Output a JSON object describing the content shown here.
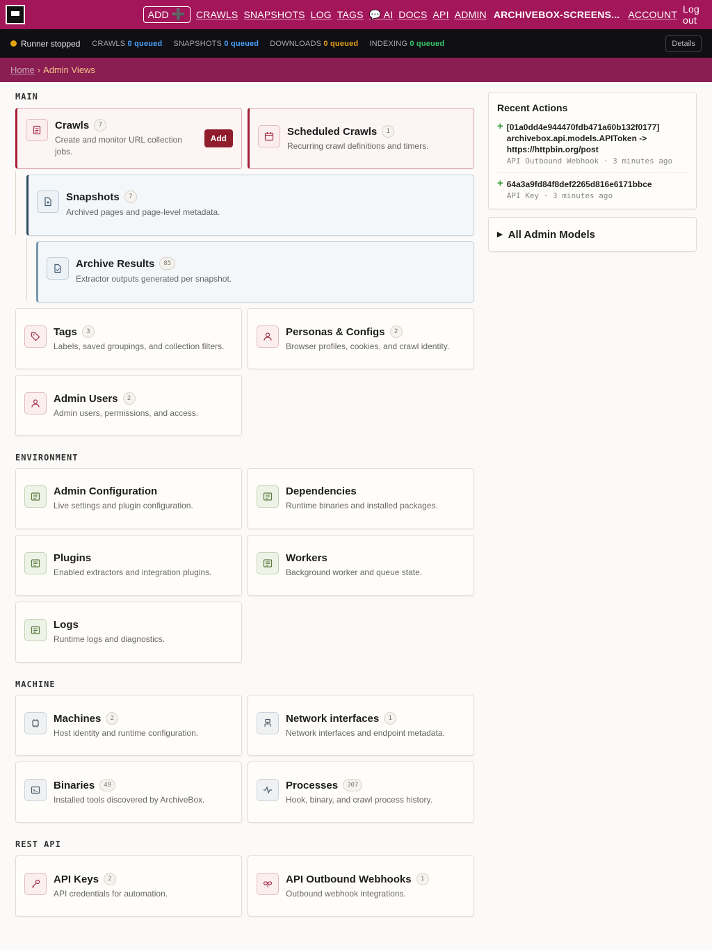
{
  "nav": {
    "add_label": "ADD",
    "links": [
      "CRAWLS",
      "SNAPSHOTS",
      "LOG",
      "TAGS",
      "💬 AI",
      "DOCS",
      "API",
      "ADMIN"
    ],
    "instance": "ARCHIVEBOX-SCREENS...",
    "account": "ACCOUNT",
    "logout": "Log out"
  },
  "status": {
    "runner": "Runner stopped",
    "crawls_label": "CRAWLS",
    "crawls_value": "0 queued",
    "snapshots_label": "SNAPSHOTS",
    "snapshots_value": "0 queued",
    "downloads_label": "DOWNLOADS",
    "downloads_value": "0 queued",
    "indexing_label": "INDEXING",
    "indexing_value": "0 queued",
    "details": "Details"
  },
  "breadcrumb": {
    "home": "Home",
    "sep": "›",
    "current": "Admin Views"
  },
  "sections": {
    "main": "MAIN",
    "environment": "ENVIRONMENT",
    "machine": "MACHINE",
    "rest_api": "REST API"
  },
  "cards": {
    "crawls": {
      "title": "Crawls",
      "count": "7",
      "desc": "Create and monitor URL collection jobs.",
      "add": "Add"
    },
    "scheduled": {
      "title": "Scheduled Crawls",
      "count": "1",
      "desc": "Recurring crawl definitions and timers."
    },
    "snapshots": {
      "title": "Snapshots",
      "count": "7",
      "desc": "Archived pages and page-level metadata."
    },
    "archive_results": {
      "title": "Archive Results",
      "count": "85",
      "desc": "Extractor outputs generated per snapshot."
    },
    "tags": {
      "title": "Tags",
      "count": "3",
      "desc": "Labels, saved groupings, and collection filters."
    },
    "personas": {
      "title": "Personas & Configs",
      "count": "2",
      "desc": "Browser profiles, cookies, and crawl identity."
    },
    "admin_users": {
      "title": "Admin Users",
      "count": "2",
      "desc": "Admin users, permissions, and access."
    },
    "admin_config": {
      "title": "Admin Configuration",
      "desc": "Live settings and plugin configuration."
    },
    "dependencies": {
      "title": "Dependencies",
      "desc": "Runtime binaries and installed packages."
    },
    "plugins": {
      "title": "Plugins",
      "desc": "Enabled extractors and integration plugins."
    },
    "workers": {
      "title": "Workers",
      "desc": "Background worker and queue state."
    },
    "logs": {
      "title": "Logs",
      "desc": "Runtime logs and diagnostics."
    },
    "machines": {
      "title": "Machines",
      "count": "2",
      "desc": "Host identity and runtime configuration."
    },
    "network": {
      "title": "Network interfaces",
      "count": "1",
      "desc": "Network interfaces and endpoint metadata."
    },
    "binaries": {
      "title": "Binaries",
      "count": "49",
      "desc": "Installed tools discovered by ArchiveBox."
    },
    "processes": {
      "title": "Processes",
      "count": "307",
      "desc": "Hook, binary, and crawl process history."
    },
    "api_keys": {
      "title": "API Keys",
      "count": "2",
      "desc": "API credentials for automation."
    },
    "webhooks": {
      "title": "API Outbound Webhooks",
      "count": "1",
      "desc": "Outbound webhook integrations."
    }
  },
  "recent": {
    "title": "Recent Actions",
    "actions": [
      {
        "line1": "[01a0dd4e944470fdb471a60b132f0177]",
        "line2": "archivebox.api.models.APIToken ->",
        "line3": "https://httpbin.org/post",
        "meta": "API Outbound Webhook · 3 minutes ago"
      },
      {
        "line1": "64a3a9fd84f8def2265d816e6171bbce",
        "meta": "API Key · 3 minutes ago"
      }
    ]
  },
  "all_models": "All Admin Models"
}
